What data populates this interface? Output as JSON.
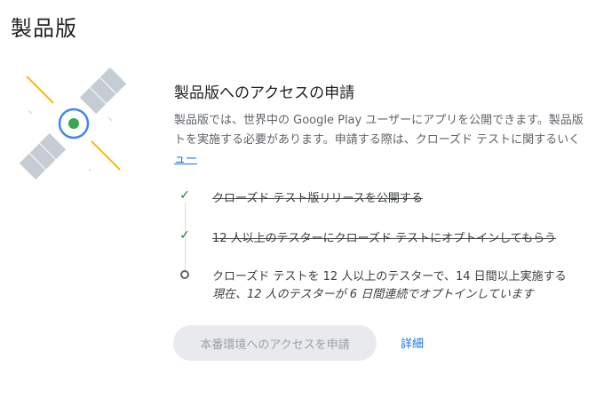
{
  "page": {
    "title": "製品版"
  },
  "section": {
    "title": "製品版へのアクセスの申請",
    "description_line1": "製品版では、世界中の Google Play ユーザーにアプリを公開できます。製品版",
    "description_line2": "トを実施する必要があります。申請する際は、クローズド テストに関するいく",
    "description_link": "ュー"
  },
  "steps": [
    {
      "status": "done",
      "text": "クローズド テスト版リリースを公開する"
    },
    {
      "status": "done",
      "text": "12 人以上のテスターにクローズド テストにオプトインしてもらう"
    },
    {
      "status": "pending",
      "text": "クローズド テストを 12 人以上のテスターで、14 日間以上実施する",
      "subtext": "現在、12 人のテスターが 6 日間連続でオプトインしています"
    }
  ],
  "actions": {
    "apply_label": "本番環境へのアクセスを申請",
    "details_label": "詳細"
  },
  "illustration": {
    "icon": "satellite-icon",
    "colors": {
      "panel": "#c5ccd3",
      "beam": "#fbbc04",
      "ring": "#4285f4",
      "core": "#34a853"
    }
  },
  "colors": {
    "check": "#188038",
    "link": "#1a73e8",
    "disabled_button_bg": "#e8eaed",
    "disabled_button_text": "#9aa0a6"
  }
}
